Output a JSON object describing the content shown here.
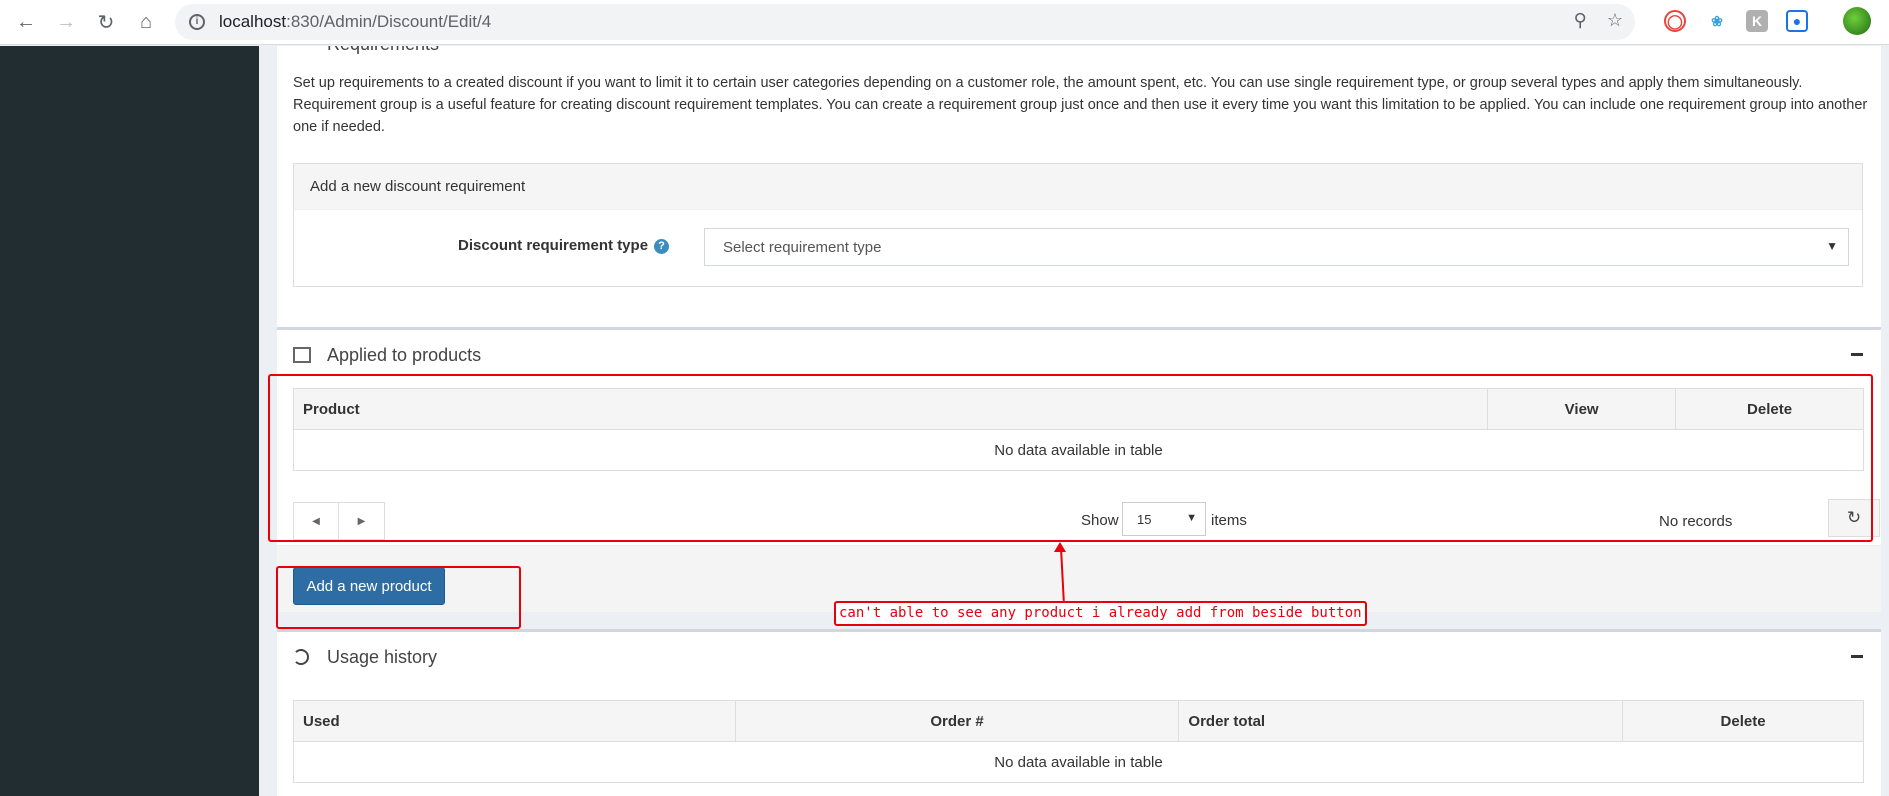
{
  "browser": {
    "url_host": "localhost",
    "url_rest": ":830/Admin/Discount/Edit/4"
  },
  "requirements": {
    "title": "Requirements",
    "description": "Set up requirements to a created discount if you want to limit it to certain user categories depending on a customer role, the amount spent, etc. You can use single requirement type, or group several types and apply them simultaneously. Requirement group is a useful feature for creating discount requirement templates. You can create a requirement group just once and then use it every time you want this limitation to be applied. You can include one requirement group into another one if needed.",
    "add_heading": "Add a new discount requirement",
    "type_label": "Discount requirement type",
    "type_placeholder": "Select requirement type"
  },
  "applied_products": {
    "title": "Applied to products",
    "columns": [
      "Product",
      "View",
      "Delete"
    ],
    "empty_text": "No data available in table",
    "show_label": "Show",
    "page_size": "15",
    "items_label": "items",
    "records_text": "No records",
    "add_button": "Add a new product"
  },
  "usage_history": {
    "title": "Usage history",
    "columns": [
      "Used",
      "Order #",
      "Order total",
      "Delete"
    ],
    "empty_text": "No data available in table"
  },
  "annotation": {
    "note": "can't able to see any product i already add from beside button",
    "color": "#e8000b"
  }
}
